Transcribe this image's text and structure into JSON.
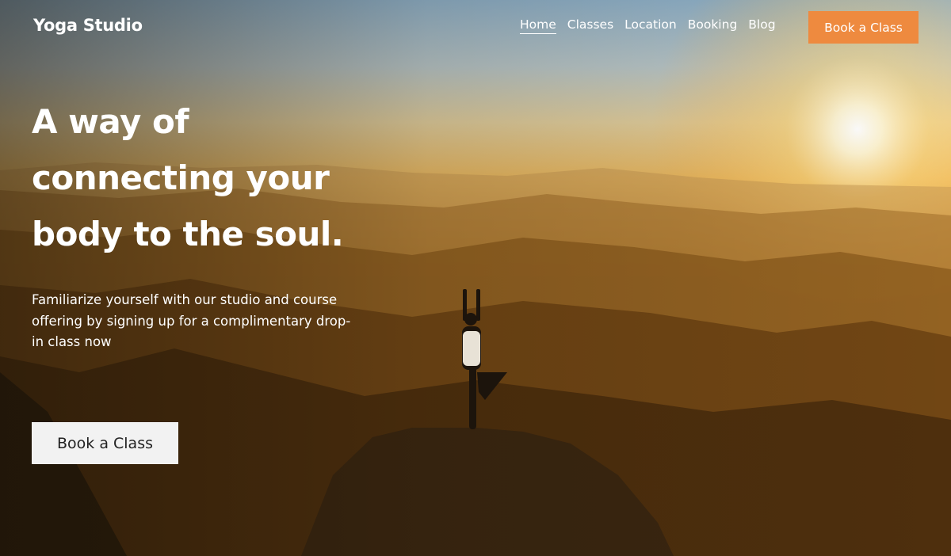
{
  "site": {
    "brand": "Yoga Studio"
  },
  "nav": {
    "items": [
      "Home",
      "Classes",
      "Location",
      "Booking",
      "Blog"
    ],
    "active": "Home"
  },
  "header_cta": {
    "label": "Book a Class",
    "color": "#ee8a3f"
  },
  "hero": {
    "headline_lines": [
      "A way of",
      "connecting your",
      "body to the soul."
    ],
    "subtext_lines": [
      "Familiarize yourself with our studio and course",
      "offering by signing up for a complimentary drop-",
      "in class now"
    ],
    "cta_label": "Book a Class"
  }
}
